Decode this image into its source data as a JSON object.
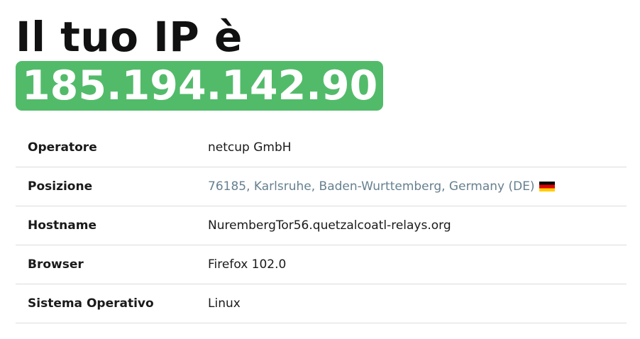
{
  "heading": "Il tuo IP è",
  "ip_address": "185.194.142.90",
  "colors": {
    "ip_badge_bg": "#52bb6a",
    "link": "#66808f"
  },
  "details": [
    {
      "label": "Operatore",
      "value": "netcup GmbH"
    },
    {
      "label": "Posizione",
      "value": "76185, Karlsruhe, Baden-Wurttemberg, Germany (DE)",
      "flag_icon": "germany-flag-icon"
    },
    {
      "label": "Hostname",
      "value": "NurembergTor56.quetzalcoatl-relays.org"
    },
    {
      "label": "Browser",
      "value": "Firefox 102.0"
    },
    {
      "label": "Sistema Operativo",
      "value": "Linux"
    }
  ]
}
